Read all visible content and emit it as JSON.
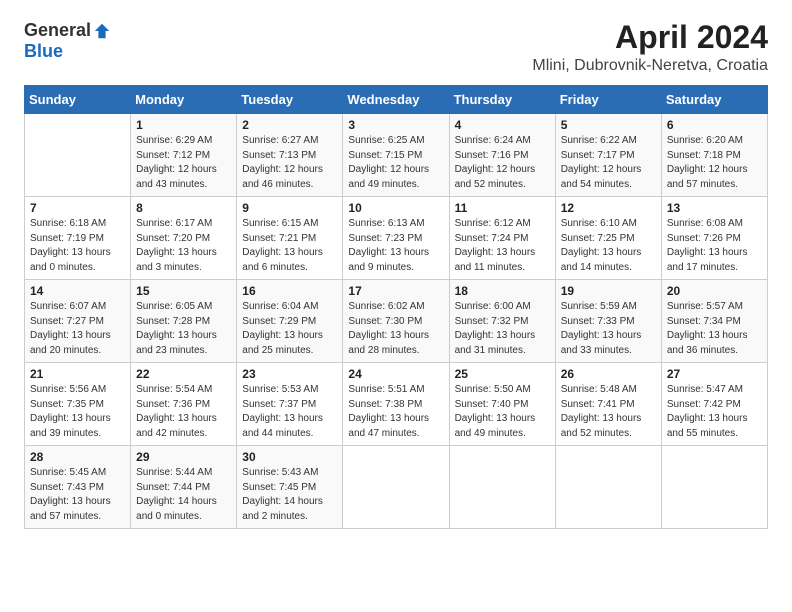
{
  "logo": {
    "general": "General",
    "blue": "Blue"
  },
  "title": "April 2024",
  "subtitle": "Mlini, Dubrovnik-Neretva, Croatia",
  "days_of_week": [
    "Sunday",
    "Monday",
    "Tuesday",
    "Wednesday",
    "Thursday",
    "Friday",
    "Saturday"
  ],
  "weeks": [
    [
      {
        "day": "",
        "info": ""
      },
      {
        "day": "1",
        "info": "Sunrise: 6:29 AM\nSunset: 7:12 PM\nDaylight: 12 hours\nand 43 minutes."
      },
      {
        "day": "2",
        "info": "Sunrise: 6:27 AM\nSunset: 7:13 PM\nDaylight: 12 hours\nand 46 minutes."
      },
      {
        "day": "3",
        "info": "Sunrise: 6:25 AM\nSunset: 7:15 PM\nDaylight: 12 hours\nand 49 minutes."
      },
      {
        "day": "4",
        "info": "Sunrise: 6:24 AM\nSunset: 7:16 PM\nDaylight: 12 hours\nand 52 minutes."
      },
      {
        "day": "5",
        "info": "Sunrise: 6:22 AM\nSunset: 7:17 PM\nDaylight: 12 hours\nand 54 minutes."
      },
      {
        "day": "6",
        "info": "Sunrise: 6:20 AM\nSunset: 7:18 PM\nDaylight: 12 hours\nand 57 minutes."
      }
    ],
    [
      {
        "day": "7",
        "info": "Sunrise: 6:18 AM\nSunset: 7:19 PM\nDaylight: 13 hours\nand 0 minutes."
      },
      {
        "day": "8",
        "info": "Sunrise: 6:17 AM\nSunset: 7:20 PM\nDaylight: 13 hours\nand 3 minutes."
      },
      {
        "day": "9",
        "info": "Sunrise: 6:15 AM\nSunset: 7:21 PM\nDaylight: 13 hours\nand 6 minutes."
      },
      {
        "day": "10",
        "info": "Sunrise: 6:13 AM\nSunset: 7:23 PM\nDaylight: 13 hours\nand 9 minutes."
      },
      {
        "day": "11",
        "info": "Sunrise: 6:12 AM\nSunset: 7:24 PM\nDaylight: 13 hours\nand 11 minutes."
      },
      {
        "day": "12",
        "info": "Sunrise: 6:10 AM\nSunset: 7:25 PM\nDaylight: 13 hours\nand 14 minutes."
      },
      {
        "day": "13",
        "info": "Sunrise: 6:08 AM\nSunset: 7:26 PM\nDaylight: 13 hours\nand 17 minutes."
      }
    ],
    [
      {
        "day": "14",
        "info": "Sunrise: 6:07 AM\nSunset: 7:27 PM\nDaylight: 13 hours\nand 20 minutes."
      },
      {
        "day": "15",
        "info": "Sunrise: 6:05 AM\nSunset: 7:28 PM\nDaylight: 13 hours\nand 23 minutes."
      },
      {
        "day": "16",
        "info": "Sunrise: 6:04 AM\nSunset: 7:29 PM\nDaylight: 13 hours\nand 25 minutes."
      },
      {
        "day": "17",
        "info": "Sunrise: 6:02 AM\nSunset: 7:30 PM\nDaylight: 13 hours\nand 28 minutes."
      },
      {
        "day": "18",
        "info": "Sunrise: 6:00 AM\nSunset: 7:32 PM\nDaylight: 13 hours\nand 31 minutes."
      },
      {
        "day": "19",
        "info": "Sunrise: 5:59 AM\nSunset: 7:33 PM\nDaylight: 13 hours\nand 33 minutes."
      },
      {
        "day": "20",
        "info": "Sunrise: 5:57 AM\nSunset: 7:34 PM\nDaylight: 13 hours\nand 36 minutes."
      }
    ],
    [
      {
        "day": "21",
        "info": "Sunrise: 5:56 AM\nSunset: 7:35 PM\nDaylight: 13 hours\nand 39 minutes."
      },
      {
        "day": "22",
        "info": "Sunrise: 5:54 AM\nSunset: 7:36 PM\nDaylight: 13 hours\nand 42 minutes."
      },
      {
        "day": "23",
        "info": "Sunrise: 5:53 AM\nSunset: 7:37 PM\nDaylight: 13 hours\nand 44 minutes."
      },
      {
        "day": "24",
        "info": "Sunrise: 5:51 AM\nSunset: 7:38 PM\nDaylight: 13 hours\nand 47 minutes."
      },
      {
        "day": "25",
        "info": "Sunrise: 5:50 AM\nSunset: 7:40 PM\nDaylight: 13 hours\nand 49 minutes."
      },
      {
        "day": "26",
        "info": "Sunrise: 5:48 AM\nSunset: 7:41 PM\nDaylight: 13 hours\nand 52 minutes."
      },
      {
        "day": "27",
        "info": "Sunrise: 5:47 AM\nSunset: 7:42 PM\nDaylight: 13 hours\nand 55 minutes."
      }
    ],
    [
      {
        "day": "28",
        "info": "Sunrise: 5:45 AM\nSunset: 7:43 PM\nDaylight: 13 hours\nand 57 minutes."
      },
      {
        "day": "29",
        "info": "Sunrise: 5:44 AM\nSunset: 7:44 PM\nDaylight: 14 hours\nand 0 minutes."
      },
      {
        "day": "30",
        "info": "Sunrise: 5:43 AM\nSunset: 7:45 PM\nDaylight: 14 hours\nand 2 minutes."
      },
      {
        "day": "",
        "info": ""
      },
      {
        "day": "",
        "info": ""
      },
      {
        "day": "",
        "info": ""
      },
      {
        "day": "",
        "info": ""
      }
    ]
  ]
}
